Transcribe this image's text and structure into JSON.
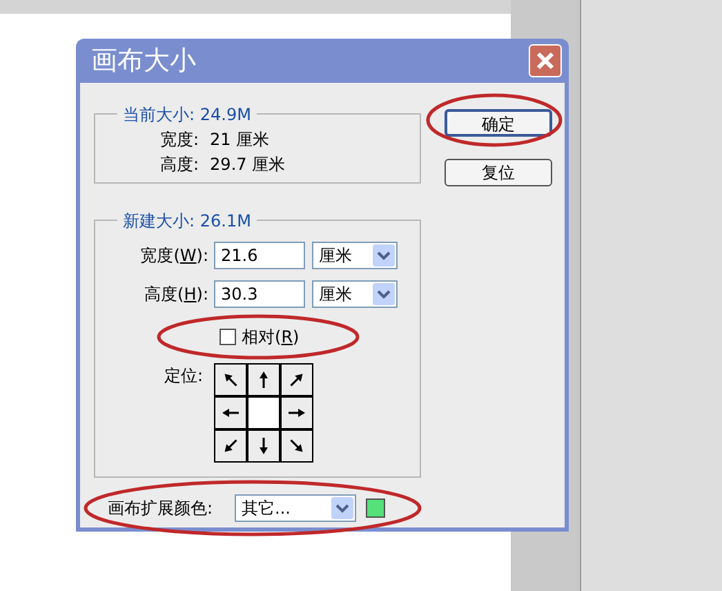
{
  "window": {
    "title": "画布大小"
  },
  "current_size": {
    "legend": "当前大小: 24.9M",
    "rows": [
      {
        "label": "宽度:",
        "value": "21 厘米"
      },
      {
        "label": "高度:",
        "value": "29.7 厘米"
      }
    ]
  },
  "buttons": [
    {
      "label": "确定",
      "default": true
    },
    {
      "label": "复位",
      "default": false
    }
  ],
  "new_size": {
    "legend": "新建大小: 26.1M",
    "fields": [
      {
        "before": "宽度(",
        "key": "W",
        "after": "):",
        "value": "21.6",
        "unit": "厘米"
      },
      {
        "before": "高度(",
        "key": "H",
        "after": "):",
        "value": "30.3",
        "unit": "厘米"
      }
    ],
    "relative": {
      "before": "相对(",
      "key": "R",
      "after": ")",
      "checked": false
    },
    "anchor_label": "定位:",
    "anchor": [
      {
        "kind": "nw",
        "selected": false
      },
      {
        "kind": "n",
        "selected": false
      },
      {
        "kind": "ne",
        "selected": false
      },
      {
        "kind": "w",
        "selected": false
      },
      {
        "kind": "c",
        "selected": true
      },
      {
        "kind": "e",
        "selected": false
      },
      {
        "kind": "sw",
        "selected": false
      },
      {
        "kind": "s",
        "selected": false
      },
      {
        "kind": "se",
        "selected": false
      }
    ]
  },
  "extension_color": {
    "label": "画布扩展颜色:",
    "value": "其它...",
    "color": "#55e07a"
  }
}
